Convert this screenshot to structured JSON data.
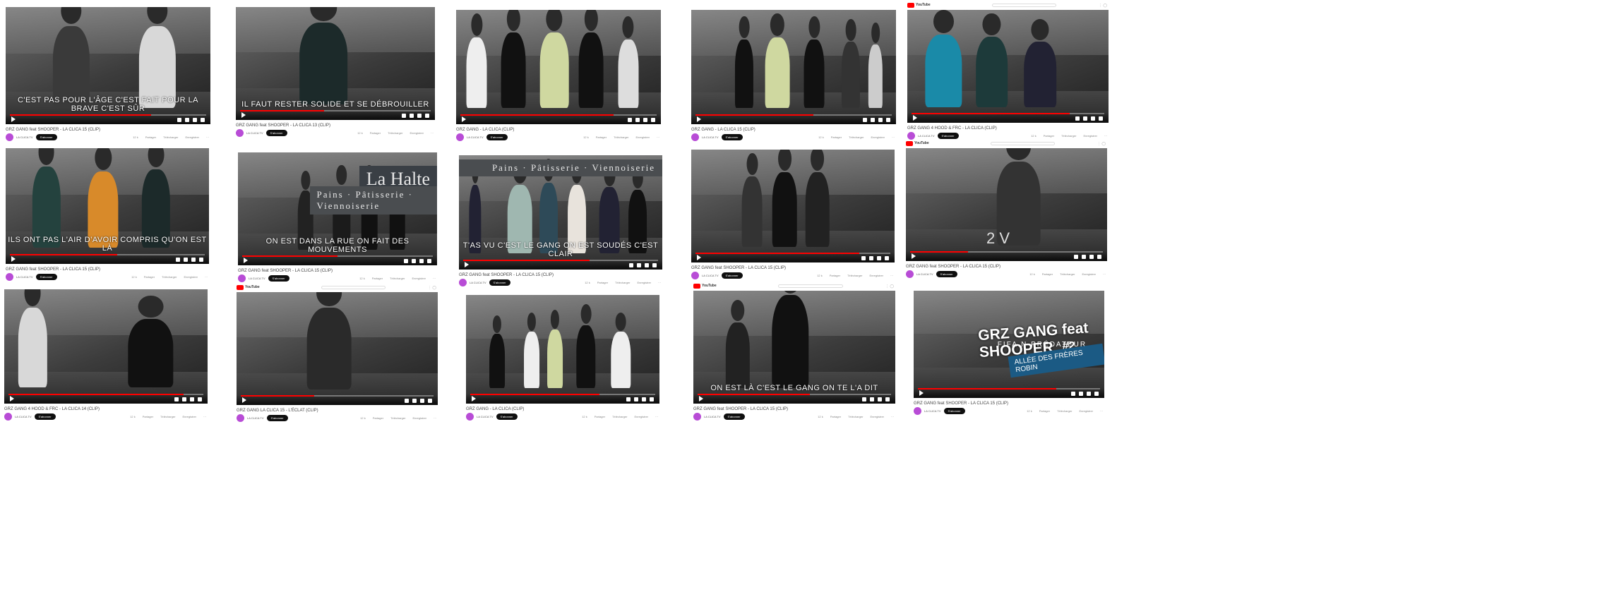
{
  "youtube": {
    "brand": "YouTube"
  },
  "colors": {
    "progress": "#ff0000",
    "avatar": "#b84cd6",
    "subscribe_bg": "#0f0f0f"
  },
  "screenshots": [
    {
      "title": "GRZ GANG feat SHOOPER - LA CLICA 15 (CLIP)",
      "channel": "LA CLICA TV",
      "subscribe": "S'abonner",
      "actions": [
        "12 k",
        "Partager",
        "Télécharger",
        "Enregistrer",
        "···"
      ],
      "overlay": "C'EST PAS POUR L'ÂGE C'EST FAIT POUR LA BRAVE C'EST SÛR",
      "progress": 0.72
    },
    {
      "title": "GRZ GANG feat SHOOPER - LA CLICA 13 (CLIP)",
      "channel": "LA CLICA TV",
      "subscribe": "S'abonner",
      "actions": [
        "12 k",
        "Partager",
        "Télécharger",
        "Enregistrer",
        "···"
      ],
      "overlay": "IL FAUT RESTER SOLIDE ET SE DÉBROUILLER",
      "progress": 0.44
    },
    {
      "title": "GRZ GANG - LA CLICA (CLIP)",
      "channel": "LA CLICA TV",
      "subscribe": "S'abonner",
      "actions": [
        "12 k",
        "Partager",
        "Télécharger",
        "Enregistrer",
        "···"
      ],
      "overlay": "",
      "progress": 0.78
    },
    {
      "title": "GRZ GANG - LA CLICA 15 (CLIP)",
      "channel": "LA CLICA TV",
      "subscribe": "S'abonner",
      "actions": [
        "12 k",
        "Partager",
        "Télécharger",
        "Enregistrer",
        "···"
      ],
      "overlay": "",
      "progress": 0.6
    },
    {
      "title": "GRZ GANG 4 HOOD & FRC - LA CLICA (CLIP)",
      "channel": "LA CLICA TV",
      "subscribe": "S'abonner",
      "actions": [
        "12 k",
        "Partager",
        "Télécharger",
        "Enregistrer",
        "···"
      ],
      "overlay": "",
      "progress": 0.82
    },
    {
      "title": "GRZ GANG feat SHOOPER - LA CLICA 15 (CLIP)",
      "channel": "LA CLICA TV",
      "subscribe": "S'abonner",
      "actions": [
        "12 k",
        "Partager",
        "Télécharger",
        "Enregistrer",
        "···"
      ],
      "overlay": "ILS ONT PAS L'AIR D'AVOIR COMPRIS QU'ON EST LÀ",
      "progress": 0.55
    },
    {
      "title": "GRZ GANG feat SHOOPER - LA CLICA 15 (CLIP)",
      "channel": "LA CLICA TV",
      "subscribe": "S'abonner",
      "actions": [
        "12 k",
        "Partager",
        "Télécharger",
        "Enregistrer",
        "···"
      ],
      "overlay": "ON EST DANS LA RUE ON FAIT DES MOUVEMENTS",
      "storefront": "La Halte",
      "storefront_sub": "Pains · Pâtisserie · Viennoiserie",
      "progress": 0.5
    },
    {
      "title": "GRZ GANG feat SHOOPER - LA CLICA 15 (CLIP)",
      "channel": "LA CLICA TV",
      "subscribe": "S'abonner",
      "actions": [
        "12 k",
        "Partager",
        "Télécharger",
        "Enregistrer",
        "···"
      ],
      "overlay": "T'AS VU C'EST LE GANG ON EST SOUDÉS C'EST CLAIR",
      "storefront": "Pains · Pâtisserie · Viennoiserie",
      "progress": 0.65
    },
    {
      "title": "GRZ GANG feat SHOOPER - LA CLICA 15 (CLIP)",
      "channel": "LA CLICA TV",
      "subscribe": "S'abonner",
      "actions": [
        "12 k",
        "Partager",
        "Télécharger",
        "Enregistrer",
        "···"
      ],
      "overlay": "",
      "progress": 0.84
    },
    {
      "title": "GRZ GANG feat SHOOPER - LA CLICA 15 (CLIP)",
      "channel": "LA CLICA TV",
      "subscribe": "S'abonner",
      "actions": [
        "12 k",
        "Partager",
        "Télécharger",
        "Enregistrer",
        "···"
      ],
      "overlay": "2 V",
      "progress": 0.3
    },
    {
      "title": "GRZ GANG 4 HOOD & FRC - LA CLICA 14 (CLIP)",
      "channel": "LA CLICA TV",
      "subscribe": "S'abonner",
      "actions": [
        "12 k",
        "Partager",
        "Télécharger",
        "Enregistrer",
        "···"
      ],
      "overlay": "",
      "progress": 0.9
    },
    {
      "title": "GRZ GANG LA CLICA 15 - L'ÉCLAT (CLIP)",
      "channel": "LA CLICA TV",
      "subscribe": "S'abonner",
      "actions": [
        "12 k",
        "Partager",
        "Télécharger",
        "Enregistrer",
        "···"
      ],
      "overlay": "",
      "progress": 0.38
    },
    {
      "title": "GRZ GANG - LA CLICA (CLIP)",
      "channel": "LA CLICA TV",
      "subscribe": "S'abonner",
      "actions": [
        "12 k",
        "Partager",
        "Télécharger",
        "Enregistrer",
        "···"
      ],
      "overlay": "",
      "progress": 0.7
    },
    {
      "title": "GRZ GANG feat SHOOPER - LA CLICA 15 (CLIP)",
      "channel": "LA CLICA TV",
      "subscribe": "S'abonner",
      "actions": [
        "12 k",
        "Partager",
        "Télécharger",
        "Enregistrer",
        "···"
      ],
      "overlay": "ON EST LÀ C'EST LE GANG ON TE L'A DIT",
      "progress": 0.58
    },
    {
      "title": "GRZ GANG feat SHOOPER - LA CLICA 15 (CLIP)",
      "channel": "LA CLICA TV",
      "subscribe": "S'abonner",
      "actions": [
        "12 k",
        "Partager",
        "Télécharger",
        "Enregistrer",
        "···"
      ],
      "overlay": "",
      "logo": "GRZ GANG feat SHOOPER",
      "logo_sub": "FIFA N PRÉDATEUR",
      "logo_badge": "#2",
      "sign": "ALLÉE DES FRÈRES ROBIN",
      "progress": 0.76
    }
  ]
}
